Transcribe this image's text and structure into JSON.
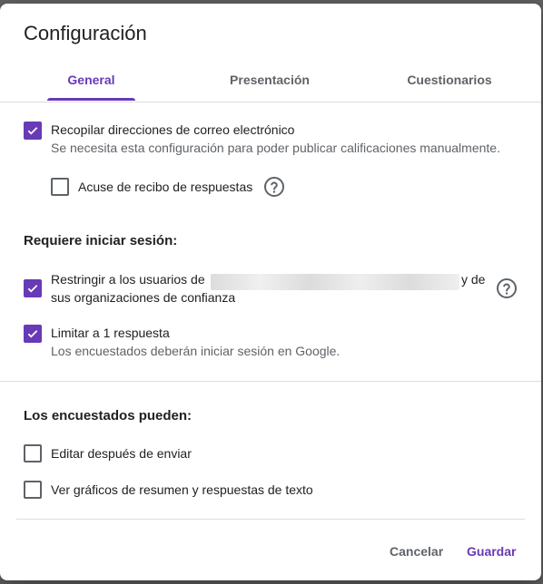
{
  "dialog": {
    "title": "Configuración",
    "tabs": [
      {
        "label": "General",
        "active": true
      },
      {
        "label": "Presentación",
        "active": false
      },
      {
        "label": "Cuestionarios",
        "active": false
      }
    ]
  },
  "general": {
    "collect_emails": {
      "label": "Recopilar direcciones de correo electrónico",
      "sub": "Se necesita esta configuración para poder publicar calificaciones manualmente.",
      "checked": true
    },
    "response_receipt": {
      "label": "Acuse de recibo de respuestas",
      "checked": false
    },
    "login_section": {
      "title": "Requiere iniciar sesión:",
      "restrict_users": {
        "label_part1": "Restringir a los usuarios de",
        "label_part2": "y de",
        "label_line2": "sus organizaciones de confianza",
        "checked": true
      },
      "limit_one": {
        "label": "Limitar a 1 respuesta",
        "sub": "Los encuestados deberán iniciar sesión en Google.",
        "checked": true
      }
    },
    "respondents_section": {
      "title": "Los encuestados pueden:",
      "edit_after": {
        "label": "Editar después de enviar",
        "checked": false
      },
      "view_summary": {
        "label": "Ver gráficos de resumen y respuestas de texto",
        "checked": false
      }
    }
  },
  "footer": {
    "cancel_label": "Cancelar",
    "save_label": "Guardar"
  },
  "colors": {
    "accent": "#673ab7",
    "text": "#202124",
    "secondary": "#5f6368"
  },
  "icons": {
    "help": "help-circle-icon",
    "check": "check-icon"
  }
}
